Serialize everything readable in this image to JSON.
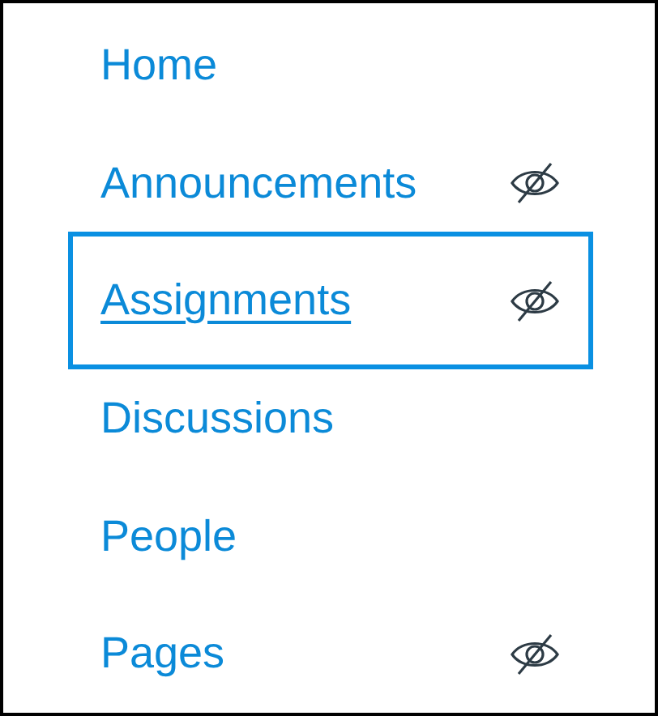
{
  "nav_items": [
    {
      "label": "Home",
      "hidden": false,
      "focused": false
    },
    {
      "label": "Announcements",
      "hidden": true,
      "focused": false
    },
    {
      "label": "Assignments",
      "hidden": true,
      "focused": true
    },
    {
      "label": "Discussions",
      "hidden": false,
      "focused": false
    },
    {
      "label": "People",
      "hidden": false,
      "focused": false
    },
    {
      "label": "Pages",
      "hidden": true,
      "focused": false
    }
  ]
}
